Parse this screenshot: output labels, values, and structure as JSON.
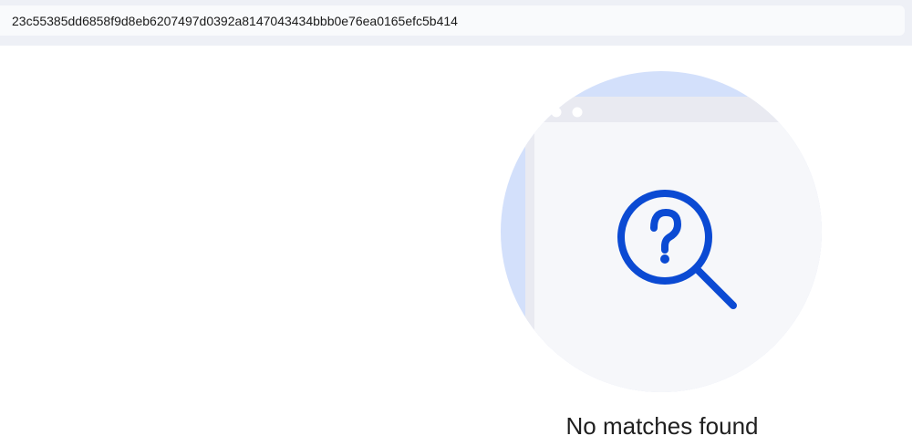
{
  "search": {
    "value": "23c55385dd6858f9d8eb6207497d0392a8147043434bbb0e76ea0165efc5b414",
    "placeholder": ""
  },
  "empty_state": {
    "message": "No matches found",
    "illustration_icon": "question-magnifier-icon"
  },
  "colors": {
    "accent": "#0b4ad3",
    "circle_bg": "#d3e0fb",
    "window_bg": "#f6f7fa",
    "window_frame": "#e9eaf1",
    "topbar_bg": "#eef0f6"
  }
}
